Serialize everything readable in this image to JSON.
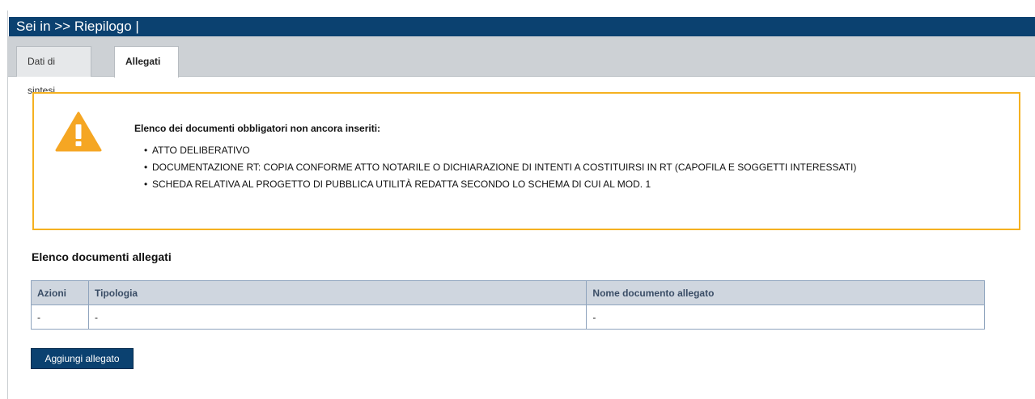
{
  "header": {
    "title": "Sei in >> Riepilogo |"
  },
  "tabs": [
    {
      "label": "Dati di sintesi",
      "active": false
    },
    {
      "label": "Allegati",
      "active": true
    }
  ],
  "warning": {
    "title": "Elenco dei documenti obbligatori non ancora inseriti:",
    "items": [
      "ATTO DELIBERATIVO",
      "DOCUMENTAZIONE RT: COPIA CONFORME ATTO NOTARILE O DICHIARAZIONE DI INTENTI A COSTITUIRSI IN RT (CAPOFILA E SOGGETTI INTERESSATI)",
      "SCHEDA RELATIVA AL PROGETTO DI PUBBLICA UTILITÀ REDATTA SECONDO LO SCHEMA DI CUI AL MOD. 1"
    ],
    "icon": "warning-triangle-icon",
    "color": "#f5a623"
  },
  "documents": {
    "title": "Elenco documenti allegati",
    "columns": [
      "Azioni",
      "Tipologia",
      "Nome documento allegato"
    ],
    "rows": [
      [
        "-",
        "-",
        "-"
      ]
    ],
    "add_button_label": "Aggiungi allegato"
  },
  "colors": {
    "brand": "#0b4170",
    "warning_border": "#f5b120",
    "table_header_bg": "#cfd6df"
  }
}
